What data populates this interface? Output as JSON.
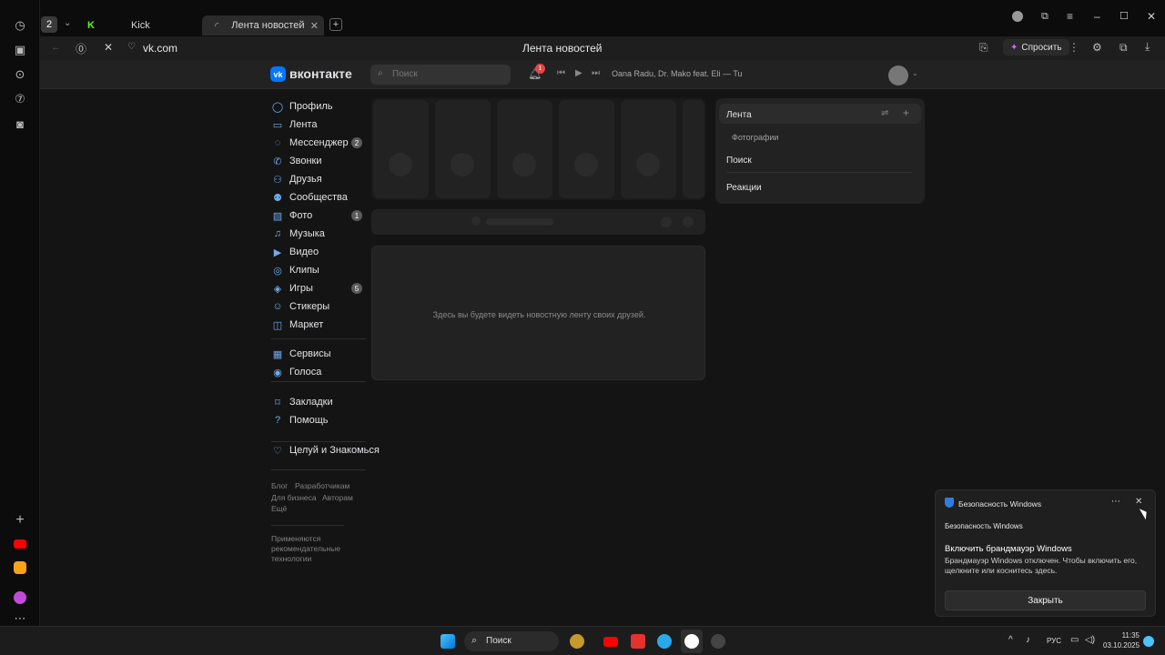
{
  "browser": {
    "tab_count": "2",
    "tabs": [
      {
        "label": "Kick"
      },
      {
        "label": "Лента новостей"
      }
    ],
    "address": "vk.com",
    "page_title": "Лента новостей",
    "ask_label": "Спросить"
  },
  "vk": {
    "logo": "вконтакте",
    "search_placeholder": "Поиск",
    "notif_count": "1",
    "now_playing": "Oana Radu, Dr. Mako feat. Eli — Tu",
    "nav": [
      {
        "label": "Профиль",
        "icon": "profile-icon"
      },
      {
        "label": "Лента",
        "icon": "feed-icon"
      },
      {
        "label": "Мессенджер",
        "icon": "messenger-icon",
        "badge": "2"
      },
      {
        "label": "Звонки",
        "icon": "phone-icon"
      },
      {
        "label": "Друзья",
        "icon": "friends-icon"
      },
      {
        "label": "Сообщества",
        "icon": "communities-icon"
      },
      {
        "label": "Фото",
        "icon": "photo-icon",
        "badge": "1"
      },
      {
        "label": "Музыка",
        "icon": "music-icon"
      },
      {
        "label": "Видео",
        "icon": "video-icon"
      },
      {
        "label": "Клипы",
        "icon": "clips-icon"
      },
      {
        "label": "Игры",
        "icon": "games-icon",
        "badge": "5"
      },
      {
        "label": "Стикеры",
        "icon": "stickers-icon"
      },
      {
        "label": "Маркет",
        "icon": "market-icon"
      },
      {
        "label": "Сервисы",
        "icon": "services-icon"
      },
      {
        "label": "Голоса",
        "icon": "votes-icon"
      },
      {
        "label": "Закладки",
        "icon": "bookmarks-icon"
      },
      {
        "label": "Помощь",
        "icon": "help-icon"
      },
      {
        "label": "Целуй и Знакомься",
        "icon": "dating-icon"
      }
    ],
    "footer": {
      "blog": "Блог",
      "developers": "Разработчикам",
      "business": "Для бизнеса",
      "authors": "Авторам",
      "more": "Ещё",
      "recommend": "Применяются рекомендательные технологии"
    },
    "empty_feed": "Здесь вы будете видеть новостную ленту своих друзей.",
    "right_menu": [
      {
        "label": "Лента"
      },
      {
        "label": "Фотографии"
      },
      {
        "label": "Поиск"
      },
      {
        "label": "Реакции"
      }
    ]
  },
  "toast": {
    "app": "Безопасность Windows",
    "source": "Безопасность Windows",
    "title": "Включить брандмауэр Windows",
    "body": "Брандмауэр Windows отключен. Чтобы включить его, щелкните или коснитесь здесь.",
    "button": "Закрыть"
  },
  "taskbar": {
    "search": "Поиск",
    "lang": "РУС",
    "time": "11:35",
    "date": "03.10.2025"
  }
}
